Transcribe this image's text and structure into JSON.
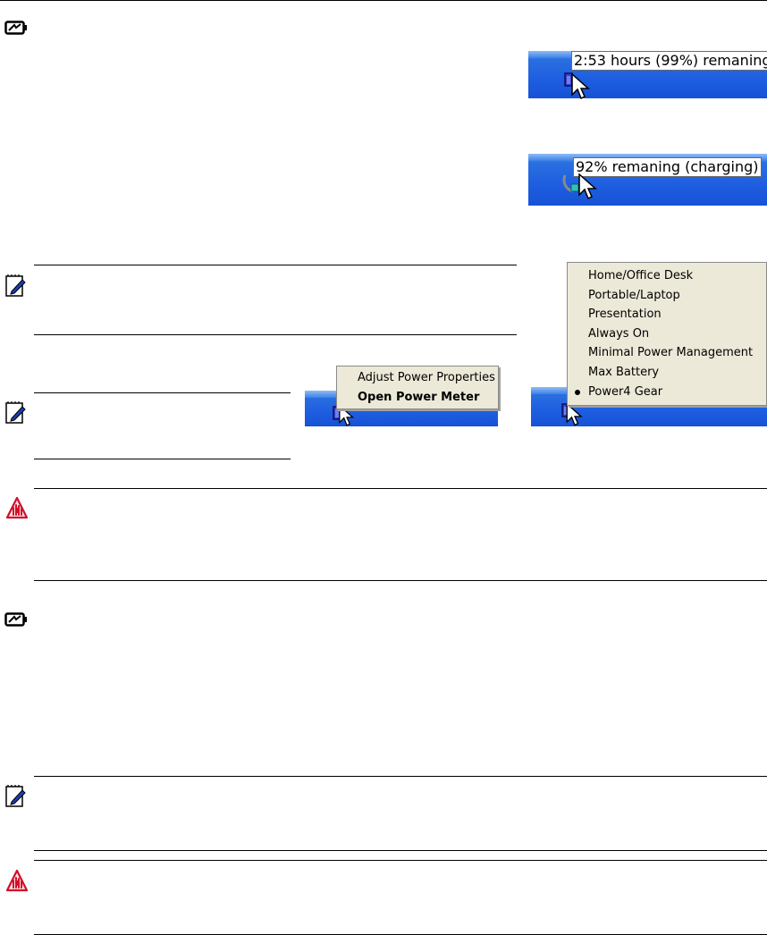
{
  "battery_tooltip": {
    "text": "2:53 hours (99%) remaning"
  },
  "charging_tooltip": {
    "text": "92% remaning (charging)"
  },
  "power_menu": {
    "items": [
      {
        "label": "Adjust Power Properties",
        "bold": false
      },
      {
        "label": "Open Power Meter",
        "bold": true
      }
    ]
  },
  "gear_menu": {
    "items": [
      {
        "label": "Home/Office Desk",
        "selected": false
      },
      {
        "label": "Portable/Laptop",
        "selected": false
      },
      {
        "label": "Presentation",
        "selected": false
      },
      {
        "label": "Always On",
        "selected": false
      },
      {
        "label": "Minimal Power Management",
        "selected": false
      },
      {
        "label": "Max Battery",
        "selected": false
      },
      {
        "label": "Power4 Gear",
        "selected": true
      }
    ]
  },
  "icons": {
    "battery": "battery-icon",
    "note": "note-pencil-icon",
    "warning": "warning-hand-icon",
    "cursor": "mouse-pointer-icon",
    "power_plug": "power-plug-icon"
  },
  "colors": {
    "taskbar_blue": "#1e5ee0",
    "menu_bg": "#ece9d8",
    "warning_red": "#d0102a",
    "note_blue": "#1a3fb0"
  }
}
